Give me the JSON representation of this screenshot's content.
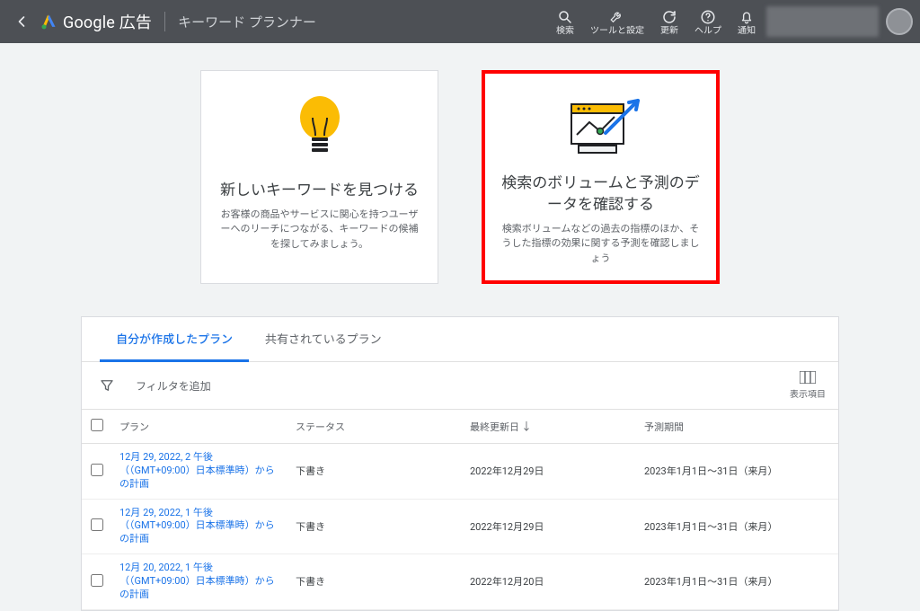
{
  "header": {
    "brand": "Google 広告",
    "page_name": "キーワード プランナー",
    "nav": {
      "search": "検索",
      "tools": "ツールと設定",
      "refresh": "更新",
      "help": "ヘルプ",
      "notif": "通知"
    }
  },
  "cards": {
    "discover": {
      "title": "新しいキーワードを見つける",
      "desc": "お客様の商品やサービスに関心を持つユーザーへのリーチにつながる、キーワードの候補を探してみましょう。"
    },
    "forecast": {
      "title": "検索のボリュームと予測のデータを確認する",
      "desc": "検索ボリュームなどの過去の指標のほか、そうした指標の効果に関する予測を確認しましょう"
    }
  },
  "plans": {
    "tabs": {
      "mine": "自分が作成したプラン",
      "shared": "共有されているプラン"
    },
    "toolbar": {
      "add_filter": "フィルタを追加",
      "columns": "表示項目"
    },
    "columns": {
      "plan": "プラン",
      "status": "ステータス",
      "updated": "最終更新日",
      "period": "予測期間"
    },
    "rows": [
      {
        "plan": "12月 29, 2022, 2 午後（（GMT+09:00）日本標準時）からの計画",
        "status": "下書き",
        "updated": "2022年12月29日",
        "period": "2023年1月1日〜31日（来月）"
      },
      {
        "plan": "12月 29, 2022, 1 午後（（GMT+09:00）日本標準時）からの計画",
        "status": "下書き",
        "updated": "2022年12月29日",
        "period": "2023年1月1日〜31日（来月）"
      },
      {
        "plan": "12月 20, 2022, 1 午後（（GMT+09:00）日本標準時）からの計画",
        "status": "下書き",
        "updated": "2022年12月20日",
        "period": "2023年1月1日〜31日（来月）"
      }
    ]
  }
}
